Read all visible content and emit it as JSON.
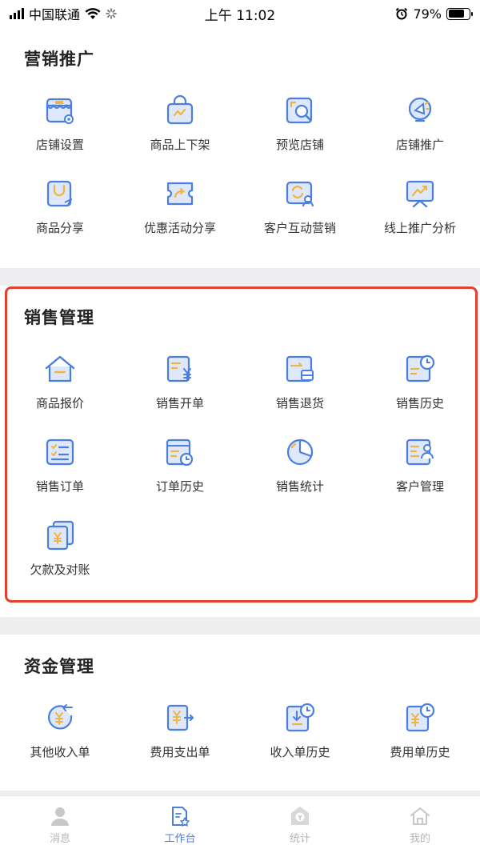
{
  "status": {
    "carrier": "中国联通",
    "time": "上午 11:02",
    "battery": "79%",
    "battery_level": 0.79
  },
  "sections": [
    {
      "title": "营销推广",
      "items": [
        {
          "label": "店铺设置",
          "icon": "shop-settings-icon"
        },
        {
          "label": "商品上下架",
          "icon": "shopping-bag-icon"
        },
        {
          "label": "预览店铺",
          "icon": "preview-shop-icon"
        },
        {
          "label": "店铺推广",
          "icon": "promotion-icon"
        },
        {
          "label": "商品分享",
          "icon": "product-share-icon"
        },
        {
          "label": "优惠活动分享",
          "icon": "coupon-share-icon"
        },
        {
          "label": "客户互动营销",
          "icon": "customer-interaction-icon"
        },
        {
          "label": "线上推广分析",
          "icon": "online-analysis-icon"
        }
      ]
    },
    {
      "title": "销售管理",
      "items": [
        {
          "label": "商品报价",
          "icon": "product-quote-icon"
        },
        {
          "label": "销售开单",
          "icon": "sales-bill-icon"
        },
        {
          "label": "销售退货",
          "icon": "sales-return-icon"
        },
        {
          "label": "销售历史",
          "icon": "sales-history-icon"
        },
        {
          "label": "销售订单",
          "icon": "sales-order-icon"
        },
        {
          "label": "订单历史",
          "icon": "order-history-icon"
        },
        {
          "label": "销售统计",
          "icon": "sales-stats-icon"
        },
        {
          "label": "客户管理",
          "icon": "customer-manage-icon"
        },
        {
          "label": "欠款及对账",
          "icon": "debt-reconcile-icon"
        }
      ]
    },
    {
      "title": "资金管理",
      "items": [
        {
          "label": "其他收入单",
          "icon": "other-income-icon"
        },
        {
          "label": "费用支出单",
          "icon": "expense-icon"
        },
        {
          "label": "收入单历史",
          "icon": "income-history-icon"
        },
        {
          "label": "费用单历史",
          "icon": "expense-history-icon"
        }
      ]
    }
  ],
  "tabs": [
    {
      "label": "消息",
      "icon": "user-icon"
    },
    {
      "label": "工作台",
      "icon": "workbench-icon"
    },
    {
      "label": "统计",
      "icon": "stats-icon"
    },
    {
      "label": "我的",
      "icon": "home-icon"
    }
  ],
  "colors": {
    "icon_blue": "#4a7fe0",
    "icon_light": "#dfe8fb",
    "icon_accent": "#f0b440",
    "highlight": "#e3402e"
  }
}
